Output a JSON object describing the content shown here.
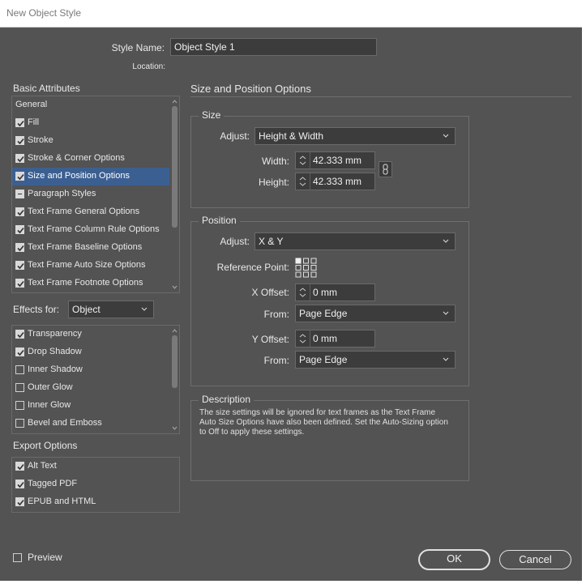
{
  "window": {
    "title": "New Object Style"
  },
  "style_name": {
    "label": "Style Name:",
    "value": "Object Style 1"
  },
  "location": {
    "label": "Location:"
  },
  "basic_attributes": {
    "heading": "Basic Attributes",
    "items": [
      {
        "label": "General",
        "state": "none"
      },
      {
        "label": "Fill",
        "state": "checked"
      },
      {
        "label": "Stroke",
        "state": "checked"
      },
      {
        "label": "Stroke & Corner Options",
        "state": "checked"
      },
      {
        "label": "Size and Position Options",
        "state": "checked",
        "selected": true
      },
      {
        "label": "Paragraph Styles",
        "state": "mixed"
      },
      {
        "label": "Text Frame General Options",
        "state": "checked"
      },
      {
        "label": "Text Frame Column Rule Options",
        "state": "checked"
      },
      {
        "label": "Text Frame Baseline Options",
        "state": "checked"
      },
      {
        "label": "Text Frame Auto Size Options",
        "state": "checked"
      },
      {
        "label": "Text Frame Footnote Options",
        "state": "checked"
      }
    ]
  },
  "effects": {
    "label": "Effects for:",
    "selected": "Object",
    "items": [
      {
        "label": "Transparency",
        "state": "checked"
      },
      {
        "label": "Drop Shadow",
        "state": "checked"
      },
      {
        "label": "Inner Shadow",
        "state": "unchecked"
      },
      {
        "label": "Outer Glow",
        "state": "unchecked"
      },
      {
        "label": "Inner Glow",
        "state": "unchecked"
      },
      {
        "label": "Bevel and Emboss",
        "state": "unchecked"
      }
    ]
  },
  "export_options": {
    "heading": "Export Options",
    "items": [
      {
        "label": "Alt Text",
        "state": "checked"
      },
      {
        "label": "Tagged PDF",
        "state": "checked"
      },
      {
        "label": "EPUB and HTML",
        "state": "checked"
      }
    ]
  },
  "panel_title": "Size and Position Options",
  "size": {
    "title": "Size",
    "adjust_label": "Adjust:",
    "adjust_value": "Height & Width",
    "width_label": "Width:",
    "width_value": "42.333 mm",
    "height_label": "Height:",
    "height_value": "42.333 mm"
  },
  "position": {
    "title": "Position",
    "adjust_label": "Adjust:",
    "adjust_value": "X & Y",
    "reference_label": "Reference Point:",
    "x_label": "X Offset:",
    "x_value": "0 mm",
    "x_from_label": "From:",
    "x_from_value": "Page Edge",
    "y_label": "Y Offset:",
    "y_value": "0 mm",
    "y_from_label": "From:",
    "y_from_value": "Page Edge"
  },
  "description": {
    "title": "Description",
    "lines": [
      "The size settings will be ignored for text frames as the Text Frame",
      "Auto Size Options have also been defined. Set the Auto-Sizing option",
      "to Off to apply these settings."
    ]
  },
  "preview": {
    "label": "Preview",
    "state": "unchecked"
  },
  "buttons": {
    "ok": "OK",
    "cancel": "Cancel"
  },
  "colors": {
    "dialog_bg": "#535353",
    "selection": "#3b5f91",
    "field_bg": "#3c3c3c"
  }
}
